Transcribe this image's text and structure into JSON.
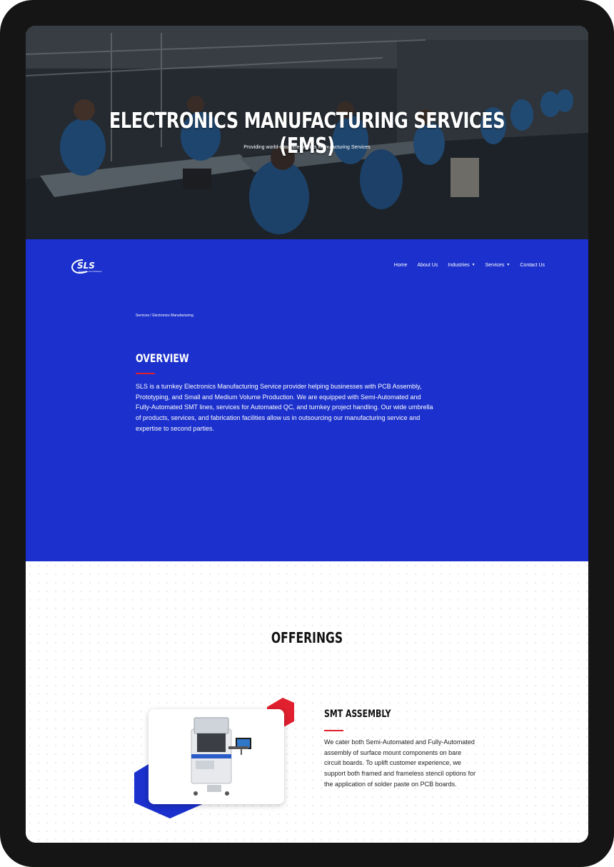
{
  "hero": {
    "title": "ELECTRONICS MANUFACTURING SERVICES (EMS)",
    "subtitle": "Providing world-class Electronics Manufacturing Services"
  },
  "brand": {
    "logo_text": "SLS",
    "tagline": "Systems Level Solutions"
  },
  "nav": {
    "items": [
      {
        "label": "Home",
        "has_dropdown": false
      },
      {
        "label": "About Us",
        "has_dropdown": false
      },
      {
        "label": "Industries",
        "has_dropdown": true
      },
      {
        "label": "Services",
        "has_dropdown": true
      },
      {
        "label": "Contact Us",
        "has_dropdown": false
      }
    ]
  },
  "breadcrumb": "Services / Electronics Manufacturing",
  "overview": {
    "title": "OVERVIEW",
    "text": "SLS is a turnkey Electronics Manufacturing Service provider helping businesses with PCB Assembly, Prototyping, and Small and Medium Volume Production. We are equipped with Semi-Automated and Fully-Automated SMT lines, services for Automated QC, and turnkey project handling. Our wide umbrella of products, services, and fabrication facilities allow us in outsourcing our manufacturing service and expertise to second parties."
  },
  "offerings": {
    "title": "OFFERINGS",
    "items": [
      {
        "title": "SMT ASSEMBLY",
        "text": "We cater both Semi-Automated and Fully-Automated assembly of surface mount components on bare circuit boards. To uplift customer experience, we support both framed and frameless stencil options for the application of solder paste on PCB boards."
      }
    ]
  },
  "colors": {
    "brand_blue": "#1b30cc",
    "accent_red": "#e0202e",
    "frame": "#151515"
  }
}
